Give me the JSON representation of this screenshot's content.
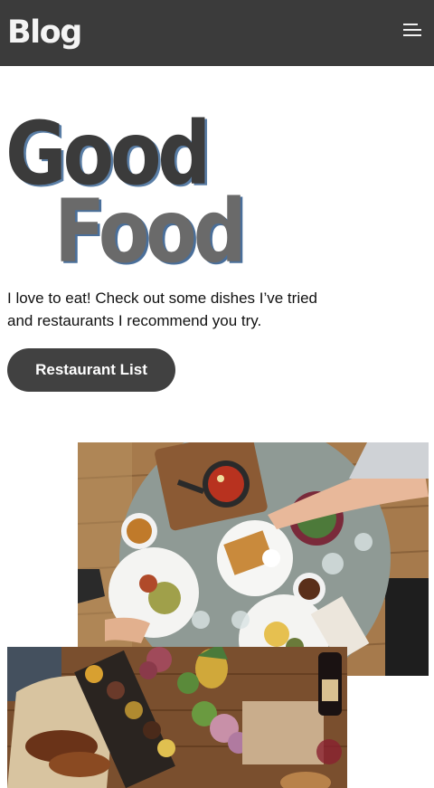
{
  "header": {
    "brand": "Blog",
    "menu_icon": "hamburger-menu-icon"
  },
  "hero": {
    "line1": "Good",
    "line2": "Food",
    "intro": "I love to eat! Check out some dishes I’ve tried and restaurants I recommend you try.",
    "cta_label": "Restaurant List"
  },
  "colors": {
    "header_bg": "#3b3b3b",
    "hero_dark": "#3b3b3b",
    "hero_gray": "#6a6a6a",
    "button_bg": "#414141"
  }
}
